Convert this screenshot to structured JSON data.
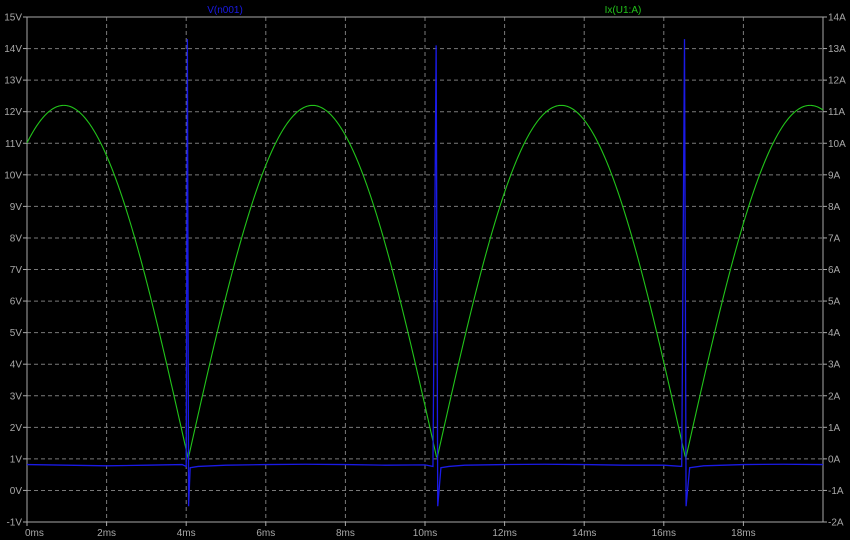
{
  "window": {
    "background": "#000000",
    "grid_color": "#7a7a7a",
    "tick_color": "#a8a8a8"
  },
  "chart_data": {
    "type": "line",
    "title": "",
    "xlabel": "",
    "ylabel": "",
    "x_unit": "ms",
    "xlim": [
      0,
      20
    ],
    "x_ticks": [
      0,
      2,
      4,
      6,
      8,
      10,
      12,
      14,
      16,
      18
    ],
    "x_tick_labels": [
      "0ms",
      "2ms",
      "4ms",
      "6ms",
      "8ms",
      "10ms",
      "12ms",
      "14ms",
      "16ms",
      "18ms"
    ],
    "y_left": {
      "unit": "V",
      "lim": [
        -1,
        15
      ],
      "ticks": [
        -1,
        0,
        1,
        2,
        3,
        4,
        5,
        6,
        7,
        8,
        9,
        10,
        11,
        12,
        13,
        14,
        15
      ],
      "tick_labels": [
        "-1V",
        "0V",
        "1V",
        "2V",
        "3V",
        "4V",
        "5V",
        "6V",
        "7V",
        "8V",
        "9V",
        "10V",
        "11V",
        "12V",
        "13V",
        "14V",
        "15V"
      ]
    },
    "y_right": {
      "unit": "A",
      "lim": [
        -2,
        14
      ],
      "ticks": [
        -2,
        -1,
        0,
        1,
        2,
        3,
        4,
        5,
        6,
        7,
        8,
        9,
        10,
        11,
        12,
        13,
        14
      ],
      "tick_labels": [
        "-2A",
        "-1A",
        "0A",
        "1A",
        "2A",
        "3A",
        "4A",
        "5A",
        "6A",
        "7A",
        "8A",
        "9A",
        "10A",
        "11A",
        "12A",
        "13A",
        "14A"
      ]
    },
    "grid": true,
    "legend": "top",
    "series": [
      {
        "name": "V(n001)",
        "axis": "left",
        "color": "#1a1ae6",
        "points": [
          [
            0,
            0.82
          ],
          [
            1,
            0.8
          ],
          [
            2,
            0.78
          ],
          [
            3,
            0.8
          ],
          [
            3.9,
            0.82
          ],
          [
            4.0,
            0.76
          ],
          [
            4.03,
            14.3
          ],
          [
            4.06,
            -0.5
          ],
          [
            4.1,
            0.72
          ],
          [
            4.3,
            0.76
          ],
          [
            5,
            0.8
          ],
          [
            6,
            0.82
          ],
          [
            7,
            0.83
          ],
          [
            8,
            0.82
          ],
          [
            9,
            0.8
          ],
          [
            10,
            0.81
          ],
          [
            10.2,
            0.76
          ],
          [
            10.28,
            14.1
          ],
          [
            10.32,
            -0.5
          ],
          [
            10.4,
            0.72
          ],
          [
            10.6,
            0.76
          ],
          [
            11,
            0.8
          ],
          [
            12,
            0.82
          ],
          [
            13,
            0.83
          ],
          [
            14,
            0.82
          ],
          [
            15,
            0.8
          ],
          [
            16,
            0.8
          ],
          [
            16.45,
            0.76
          ],
          [
            16.52,
            14.3
          ],
          [
            16.56,
            -0.5
          ],
          [
            16.65,
            0.72
          ],
          [
            17,
            0.78
          ],
          [
            18,
            0.82
          ],
          [
            19,
            0.83
          ],
          [
            20,
            0.82
          ]
        ]
      },
      {
        "name": "Ix(U1:A)",
        "axis": "right",
        "color": "#22c41a",
        "model": {
          "kind": "full-wave-rectified",
          "period_ms": 6.25,
          "first_minimum_ms": 4.05,
          "minimum_A": 0,
          "peak_A": 11.2
        }
      }
    ]
  }
}
